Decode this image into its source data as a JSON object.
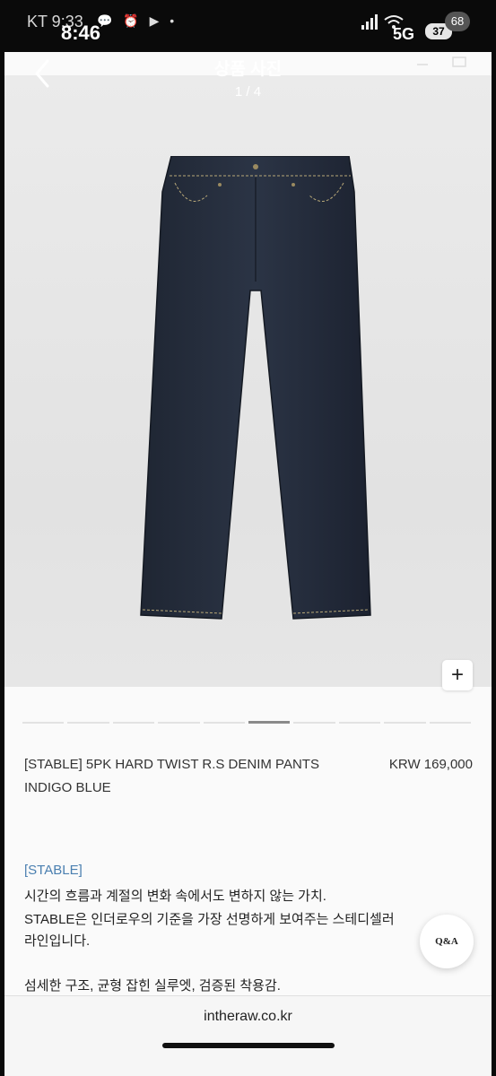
{
  "status_bar": {
    "carrier": "KT 9:33",
    "time": "8:46",
    "notification_icons": "💬 ⏰ ▶ •",
    "network": "5G",
    "battery": "37",
    "badge": "68"
  },
  "header": {
    "title": "상품 사진",
    "page_counter": "1 / 4"
  },
  "gallery": {
    "plus_label": "+",
    "pages": 10,
    "active_page": 6
  },
  "product": {
    "name": "[STABLE] 5PK HARD TWIST R.S DENIM PANTS",
    "price": "KRW 169,000",
    "color": "INDIGO BLUE"
  },
  "description": {
    "tag": "[STABLE]",
    "lines": [
      "시간의 흐름과 계절의 변화 속에서도 변하지 않는 가치.",
      "STABLE은 인더로우의 기준을 가장 선명하게 보여주는 스테디셀러",
      "라인입니다.",
      "섬세한 구조, 균형 잡힌 실루엣, 검증된 착용감."
    ]
  },
  "qa_button_label": "Q&A",
  "browser": {
    "url": "intheraw.co.kr"
  }
}
